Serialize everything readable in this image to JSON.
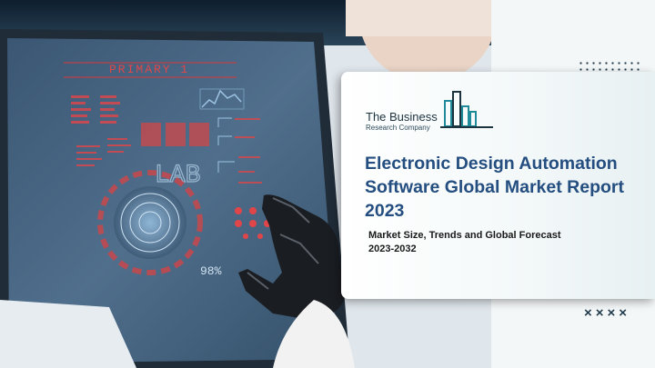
{
  "photo": {
    "screen_heading": "PRIMARY 1",
    "screen_label": "LAB",
    "gauge_readout": "98%"
  },
  "report": {
    "logo_line1": "The Business",
    "logo_line2": "Research Company",
    "title": "Electronic Design Automation Software Global Market Report 2023",
    "subtitle": "Market Size, Trends and Global Forecast 2023-2032"
  },
  "decor": {
    "crosses": "××××"
  }
}
